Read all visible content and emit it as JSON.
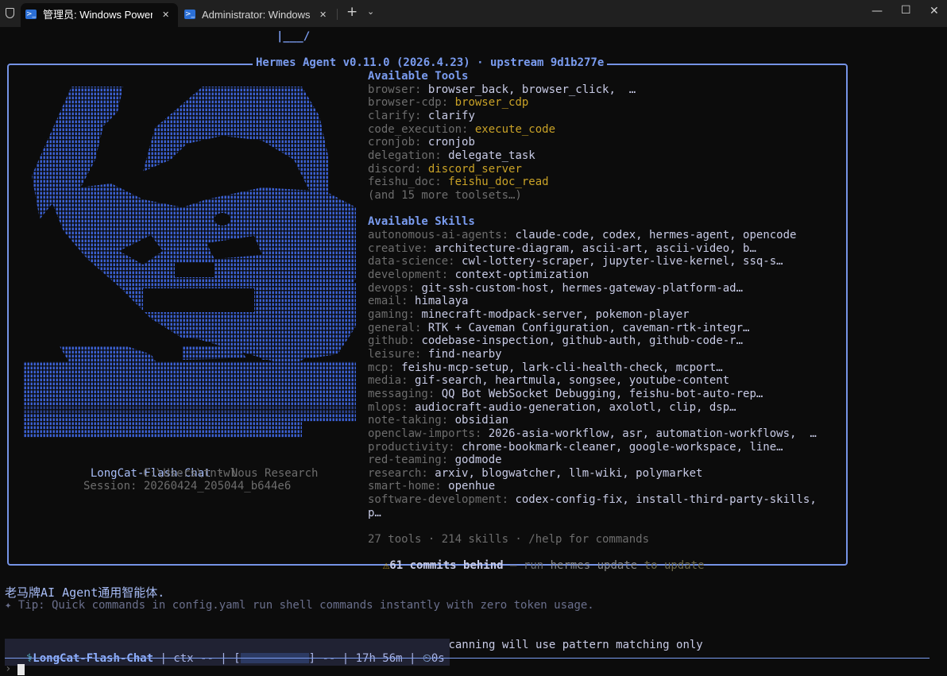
{
  "tabs": [
    {
      "label": "管理员: Windows PowerShell",
      "close": "✕",
      "icon": "powershell-icon"
    },
    {
      "label": "Administrator: Windows PowerShell",
      "close": "✕",
      "icon": "powershell-icon"
    }
  ],
  "tabbar": {
    "new_tab": "+",
    "dropdown": "⌄"
  },
  "window": {
    "minimize": "—",
    "maximize": "☐",
    "close": "✕"
  },
  "top_fragment": "|___/",
  "panel": {
    "title": "Hermes Agent v0.11.0 (2026.4.23) · upstream 9d1b277e",
    "left": {
      "model": "LongCat-Flash-Chat",
      "provider_sep": " · ",
      "provider": "Nous Research",
      "cwd": "C:\\Users\\tntwl",
      "session": "Session: 20260424_205044_b644e6"
    },
    "tools_heading": "Available Tools",
    "tools": [
      {
        "cat": "browser:",
        "val": "browser_back, browser_click,  …",
        "color": "white"
      },
      {
        "cat": "browser-cdp:",
        "val": "browser_cdp",
        "color": "gold"
      },
      {
        "cat": "clarify:",
        "val": "clarify",
        "color": "white"
      },
      {
        "cat": "code_execution:",
        "val": "execute_code",
        "color": "gold"
      },
      {
        "cat": "cronjob:",
        "val": "cronjob",
        "color": "white"
      },
      {
        "cat": "delegation:",
        "val": "delegate_task",
        "color": "white"
      },
      {
        "cat": "discord:",
        "val": "discord_server",
        "color": "gold"
      },
      {
        "cat": "feishu_doc:",
        "val": "feishu_doc_read",
        "color": "gold"
      }
    ],
    "tools_more": "(and 15 more toolsets…)",
    "skills_heading": "Available Skills",
    "skills": [
      {
        "cat": "autonomous-ai-agents:",
        "val": "claude-code, codex, hermes-agent, opencode"
      },
      {
        "cat": "creative:",
        "val": "architecture-diagram, ascii-art, ascii-video, b…"
      },
      {
        "cat": "data-science:",
        "val": "cwl-lottery-scraper, jupyter-live-kernel, ssq-s…"
      },
      {
        "cat": "development:",
        "val": "context-optimization"
      },
      {
        "cat": "devops:",
        "val": "git-ssh-custom-host, hermes-gateway-platform-ad…"
      },
      {
        "cat": "email:",
        "val": "himalaya"
      },
      {
        "cat": "gaming:",
        "val": "minecraft-modpack-server, pokemon-player"
      },
      {
        "cat": "general:",
        "val": "RTK + Caveman Configuration, caveman-rtk-integr…"
      },
      {
        "cat": "github:",
        "val": "codebase-inspection, github-auth, github-code-r…"
      },
      {
        "cat": "leisure:",
        "val": "find-nearby"
      },
      {
        "cat": "mcp:",
        "val": "feishu-mcp-setup, lark-cli-health-check, mcport…"
      },
      {
        "cat": "media:",
        "val": "gif-search, heartmula, songsee, youtube-content"
      },
      {
        "cat": "messaging:",
        "val": "QQ Bot WebSocket Debugging, feishu-bot-auto-rep…"
      },
      {
        "cat": "mlops:",
        "val": "audiocraft-audio-generation, axolotl, clip, dsp…"
      },
      {
        "cat": "note-taking:",
        "val": "obsidian"
      },
      {
        "cat": "openclaw-imports:",
        "val": "2026-asia-workflow, asr, automation-workflows,  …"
      },
      {
        "cat": "productivity:",
        "val": "chrome-bookmark-cleaner, google-workspace, line…"
      },
      {
        "cat": "red-teaming:",
        "val": "godmode"
      },
      {
        "cat": "research:",
        "val": "arxiv, blogwatcher, llm-wiki, polymarket"
      },
      {
        "cat": "smart-home:",
        "val": "openhue"
      },
      {
        "cat": "software-development:",
        "val": "codex-config-fix, install-third-party-skills,"
      }
    ],
    "skills_wrap": "p…",
    "summary": "27 tools · 214 skills · /help for commands",
    "update": {
      "icon": "⚠",
      "commits": "61 commits behind",
      "dash": " — ",
      "run": "run",
      "cmd": "hermes update",
      "to": "to",
      "upd": "update"
    }
  },
  "greeting": "老马牌AI Agent通用智能体.",
  "tip": "✦ Tip: Quick commands in config.yaml run shell commands instantly with zero token usage.",
  "warning": {
    "icon": "⚠",
    "text": "tirith security scanner enabled but not available — command scanning will use pattern matching only"
  },
  "status": {
    "icon": "⚕",
    "model": "LongCat-Flash-Chat",
    "ctx": " | ctx -- | [",
    "after_bar": "] -- | 17h 56m | ",
    "timer_icon": "⏲",
    "timer": "0s"
  },
  "prompt": "›"
}
